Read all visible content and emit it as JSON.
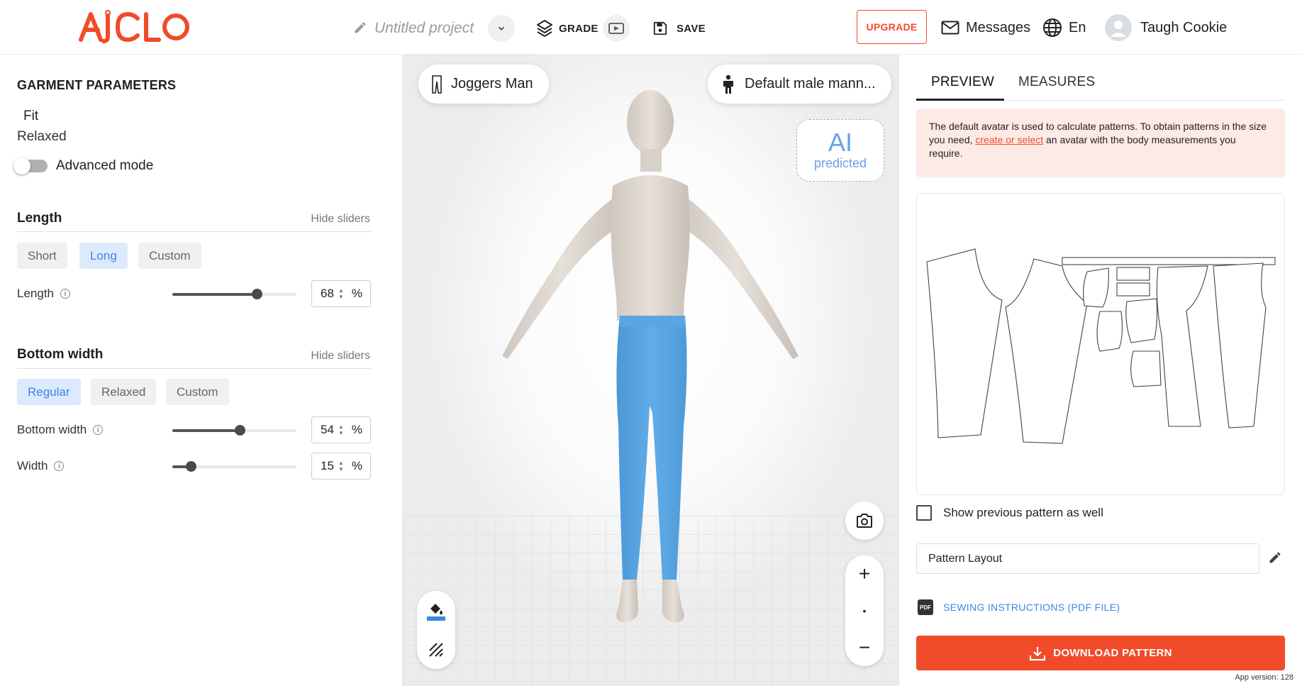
{
  "header": {
    "logo_text": "AICLO",
    "project_name": "Untitled project",
    "grade_label": "GRADE",
    "save_label": "SAVE",
    "upgrade_label": "UPGRADE",
    "messages_label": "Messages",
    "language_label": "En",
    "user_name": "Taugh Cookie"
  },
  "left": {
    "title": "GARMENT PARAMETERS",
    "fit_label": "Fit",
    "fit_value": "Relaxed",
    "advanced_mode_label": "Advanced mode",
    "advanced_mode_on": false,
    "length_section": {
      "title": "Length",
      "hide_label": "Hide sliders",
      "options": [
        "Short",
        "Long",
        "Custom"
      ],
      "selected": "Long",
      "sliders": [
        {
          "label": "Length",
          "value": "68",
          "unit": "%",
          "fraction": 0.68
        }
      ]
    },
    "bottom_section": {
      "title": "Bottom width",
      "hide_label": "Hide sliders",
      "options": [
        "Regular",
        "Relaxed",
        "Custom"
      ],
      "selected": "Regular",
      "sliders": [
        {
          "label": "Bottom width",
          "value": "54",
          "unit": "%",
          "fraction": 0.54
        },
        {
          "label": "Width",
          "value": "15",
          "unit": "%",
          "fraction": 0.15
        }
      ]
    }
  },
  "viewport": {
    "garment_label": "Joggers Man",
    "avatar_label": "Default male mann...",
    "ai_badge_big": "AI",
    "ai_badge_small": "predicted",
    "garment_color": "#5aa6e3",
    "zoom_in": "+",
    "zoom_reset": "•",
    "zoom_out": "−"
  },
  "right": {
    "tabs": [
      "PREVIEW",
      "MEASURES"
    ],
    "active_tab": "PREVIEW",
    "notice_before": "The default avatar is used to calculate patterns. To obtain patterns in the size you need, ",
    "notice_link": "create or select",
    "notice_after": " an avatar with the body measurements you require.",
    "show_previous_label": "Show previous pattern as well",
    "show_previous_checked": false,
    "pattern_layout_label": "Pattern Layout",
    "pdf_badge": "PDF",
    "sewing_instructions_label": "SEWING INSTRUCTIONS (PDF FILE)",
    "download_label": "DOWNLOAD PATTERN",
    "app_version": "App version: 128"
  },
  "colors": {
    "brand": "#f04b2a",
    "accent_blue": "#3f86e4",
    "notice_bg": "#fde9e6"
  }
}
